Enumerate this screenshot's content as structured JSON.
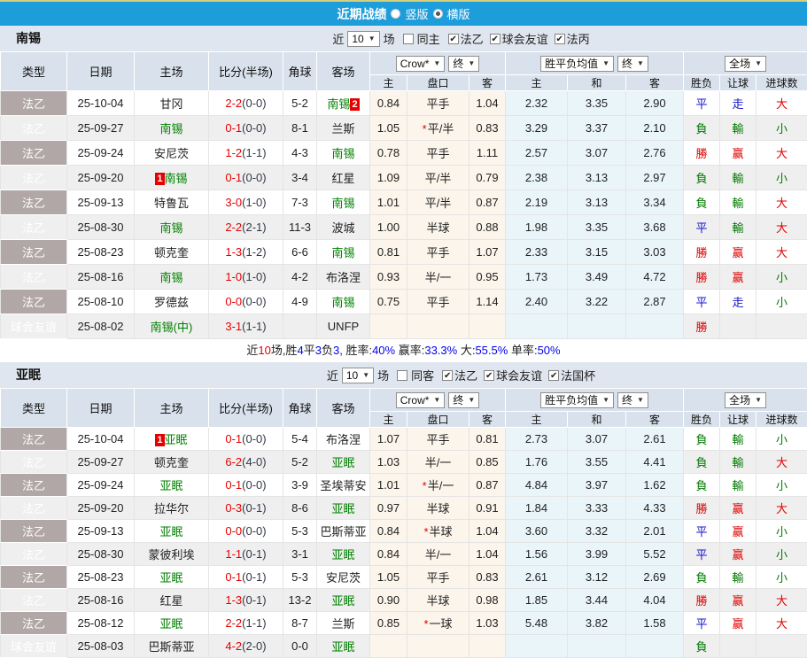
{
  "topbar": {
    "title": "近期战绩",
    "vertical": "竖版",
    "horizontal": "横版"
  },
  "value_colors": {
    "勝": "red",
    "平": "blue",
    "負": "green",
    "赢": "red",
    "走": "blue",
    "輸": "green",
    "大": "red",
    "小": "green"
  },
  "palette": {
    "topbar_blue": "#1E9DDB",
    "league_cell": "#B2A7A7",
    "friendly_cell": "#12A8A2",
    "odds_bg": "#FBF5EC",
    "avg_bg": "#EAF5FA",
    "stripe": "#EFEFEF",
    "red": "#E10000",
    "green": "#007A00",
    "blue": "#1414CC"
  },
  "sections": [
    {
      "team": "南锡",
      "near_label": "近",
      "count": "10",
      "games_label": "场",
      "same_checkbox": {
        "label": "同主",
        "checked": false
      },
      "league_checks": [
        {
          "label": "法乙",
          "checked": true
        },
        {
          "label": "球会友谊",
          "checked": true
        },
        {
          "label": "法丙",
          "checked": true
        }
      ],
      "selects": {
        "odds_company": "Crow*",
        "odds_final": "终",
        "avg": "胜平负均值",
        "avg_final": "终",
        "scope": "全场"
      },
      "columns": {
        "type": "类型",
        "date": "日期",
        "home": "主场",
        "score": "比分(半场)",
        "corner": "角球",
        "away": "客场",
        "o_home": "主",
        "o_line": "盘口",
        "o_away": "客",
        "e_home": "主",
        "e_draw": "和",
        "e_away": "客",
        "result": "胜负",
        "handicap": "让球",
        "goals": "进球数"
      },
      "rows": [
        {
          "type": "法乙",
          "friendly": false,
          "date": "25-10-04",
          "home": {
            "pre": "",
            "name": "甘冈",
            "post": "",
            "green": false
          },
          "score": "2-2",
          "half": "(0-0)",
          "corner": "5-2",
          "away": {
            "pre": "",
            "name": "南锡",
            "post": "2",
            "green": true
          },
          "star": false,
          "o1": "0.84",
          "line": "平手",
          "o2": "1.04",
          "e1": "2.32",
          "e2": "3.35",
          "e3": "2.90",
          "res": "平",
          "han": "走",
          "goal": "大"
        },
        {
          "type": "法乙",
          "friendly": false,
          "date": "25-09-27",
          "home": {
            "pre": "",
            "name": "南锡",
            "post": "",
            "green": true
          },
          "score": "0-1",
          "half": "(0-0)",
          "corner": "8-1",
          "away": {
            "pre": "",
            "name": "兰斯",
            "post": "",
            "green": false
          },
          "star": true,
          "o1": "1.05",
          "line": "平/半",
          "o2": "0.83",
          "e1": "3.29",
          "e2": "3.37",
          "e3": "2.10",
          "res": "負",
          "han": "輸",
          "goal": "小"
        },
        {
          "type": "法乙",
          "friendly": false,
          "date": "25-09-24",
          "home": {
            "pre": "",
            "name": "安尼茨",
            "post": "",
            "green": false
          },
          "score": "1-2",
          "half": "(1-1)",
          "corner": "4-3",
          "away": {
            "pre": "",
            "name": "南锡",
            "post": "",
            "green": true
          },
          "star": false,
          "o1": "0.78",
          "line": "平手",
          "o2": "1.11",
          "e1": "2.57",
          "e2": "3.07",
          "e3": "2.76",
          "res": "勝",
          "han": "赢",
          "goal": "大"
        },
        {
          "type": "法乙",
          "friendly": false,
          "date": "25-09-20",
          "home": {
            "pre": "1",
            "name": "南锡",
            "post": "",
            "green": true
          },
          "score": "0-1",
          "half": "(0-0)",
          "corner": "3-4",
          "away": {
            "pre": "",
            "name": "红星",
            "post": "",
            "green": false
          },
          "star": false,
          "o1": "1.09",
          "line": "平/半",
          "o2": "0.79",
          "e1": "2.38",
          "e2": "3.13",
          "e3": "2.97",
          "res": "負",
          "han": "輸",
          "goal": "小"
        },
        {
          "type": "法乙",
          "friendly": false,
          "date": "25-09-13",
          "home": {
            "pre": "",
            "name": "特鲁瓦",
            "post": "",
            "green": false
          },
          "score": "3-0",
          "half": "(1-0)",
          "corner": "7-3",
          "away": {
            "pre": "",
            "name": "南锡",
            "post": "",
            "green": true
          },
          "star": false,
          "o1": "1.01",
          "line": "平/半",
          "o2": "0.87",
          "e1": "2.19",
          "e2": "3.13",
          "e3": "3.34",
          "res": "負",
          "han": "輸",
          "goal": "大"
        },
        {
          "type": "法乙",
          "friendly": false,
          "date": "25-08-30",
          "home": {
            "pre": "",
            "name": "南锡",
            "post": "",
            "green": true
          },
          "score": "2-2",
          "half": "(2-1)",
          "corner": "11-3",
          "away": {
            "pre": "",
            "name": "波城",
            "post": "",
            "green": false
          },
          "star": false,
          "o1": "1.00",
          "line": "半球",
          "o2": "0.88",
          "e1": "1.98",
          "e2": "3.35",
          "e3": "3.68",
          "res": "平",
          "han": "輸",
          "goal": "大"
        },
        {
          "type": "法乙",
          "friendly": false,
          "date": "25-08-23",
          "home": {
            "pre": "",
            "name": "顿克奎",
            "post": "",
            "green": false
          },
          "score": "1-3",
          "half": "(1-2)",
          "corner": "6-6",
          "away": {
            "pre": "",
            "name": "南锡",
            "post": "",
            "green": true
          },
          "star": false,
          "o1": "0.81",
          "line": "平手",
          "o2": "1.07",
          "e1": "2.33",
          "e2": "3.15",
          "e3": "3.03",
          "res": "勝",
          "han": "赢",
          "goal": "大"
        },
        {
          "type": "法乙",
          "friendly": false,
          "date": "25-08-16",
          "home": {
            "pre": "",
            "name": "南锡",
            "post": "",
            "green": true
          },
          "score": "1-0",
          "half": "(1-0)",
          "corner": "4-2",
          "away": {
            "pre": "",
            "name": "布洛涅",
            "post": "",
            "green": false
          },
          "star": false,
          "o1": "0.93",
          "line": "半/一",
          "o2": "0.95",
          "e1": "1.73",
          "e2": "3.49",
          "e3": "4.72",
          "res": "勝",
          "han": "赢",
          "goal": "小"
        },
        {
          "type": "法乙",
          "friendly": false,
          "date": "25-08-10",
          "home": {
            "pre": "",
            "name": "罗德兹",
            "post": "",
            "green": false
          },
          "score": "0-0",
          "half": "(0-0)",
          "corner": "4-9",
          "away": {
            "pre": "",
            "name": "南锡",
            "post": "",
            "green": true
          },
          "star": false,
          "o1": "0.75",
          "line": "平手",
          "o2": "1.14",
          "e1": "2.40",
          "e2": "3.22",
          "e3": "2.87",
          "res": "平",
          "han": "走",
          "goal": "小"
        },
        {
          "type": "球会友谊",
          "friendly": true,
          "date": "25-08-02",
          "home": {
            "pre": "",
            "name": "南锡(中)",
            "post": "",
            "green": true
          },
          "score": "3-1",
          "half": "(1-1)",
          "corner": "",
          "away": {
            "pre": "",
            "name": "UNFP",
            "post": "",
            "green": false
          },
          "star": false,
          "o1": "",
          "line": "",
          "o2": "",
          "e1": "",
          "e2": "",
          "e3": "",
          "res": "勝",
          "han": "",
          "goal": ""
        }
      ],
      "summary": {
        "parts": [
          [
            "近",
            "k"
          ],
          [
            "10",
            "r"
          ],
          [
            "场,胜",
            "k"
          ],
          [
            "4",
            "b"
          ],
          [
            "平",
            "k"
          ],
          [
            "3",
            "b"
          ],
          [
            "负",
            "k"
          ],
          [
            "3",
            "b"
          ],
          [
            ", 胜率:",
            "k"
          ],
          [
            "40%",
            "b"
          ],
          [
            " 赢率:",
            "k"
          ],
          [
            "33.3%",
            "b"
          ],
          [
            " 大:",
            "k"
          ],
          [
            "55.5%",
            "b"
          ],
          [
            " 单率:",
            "k"
          ],
          [
            "50%",
            "b"
          ]
        ]
      }
    },
    {
      "team": "亚眠",
      "near_label": "近",
      "count": "10",
      "games_label": "场",
      "same_checkbox": {
        "label": "同客",
        "checked": false
      },
      "league_checks": [
        {
          "label": "法乙",
          "checked": true
        },
        {
          "label": "球会友谊",
          "checked": true
        },
        {
          "label": "法国杯",
          "checked": true
        }
      ],
      "selects": {
        "odds_company": "Crow*",
        "odds_final": "终",
        "avg": "胜平负均值",
        "avg_final": "终",
        "scope": "全场"
      },
      "columns": {
        "type": "类型",
        "date": "日期",
        "home": "主场",
        "score": "比分(半场)",
        "corner": "角球",
        "away": "客场",
        "o_home": "主",
        "o_line": "盘口",
        "o_away": "客",
        "e_home": "主",
        "e_draw": "和",
        "e_away": "客",
        "result": "胜负",
        "handicap": "让球",
        "goals": "进球数"
      },
      "rows": [
        {
          "type": "法乙",
          "friendly": false,
          "date": "25-10-04",
          "home": {
            "pre": "1",
            "name": "亚眠",
            "post": "",
            "green": true
          },
          "score": "0-1",
          "half": "(0-0)",
          "corner": "5-4",
          "away": {
            "pre": "",
            "name": "布洛涅",
            "post": "",
            "green": false
          },
          "star": false,
          "o1": "1.07",
          "line": "平手",
          "o2": "0.81",
          "e1": "2.73",
          "e2": "3.07",
          "e3": "2.61",
          "res": "負",
          "han": "輸",
          "goal": "小"
        },
        {
          "type": "法乙",
          "friendly": false,
          "date": "25-09-27",
          "home": {
            "pre": "",
            "name": "顿克奎",
            "post": "",
            "green": false
          },
          "score": "6-2",
          "half": "(4-0)",
          "corner": "5-2",
          "away": {
            "pre": "",
            "name": "亚眠",
            "post": "",
            "green": true
          },
          "star": false,
          "o1": "1.03",
          "line": "半/一",
          "o2": "0.85",
          "e1": "1.76",
          "e2": "3.55",
          "e3": "4.41",
          "res": "負",
          "han": "輸",
          "goal": "大"
        },
        {
          "type": "法乙",
          "friendly": false,
          "date": "25-09-24",
          "home": {
            "pre": "",
            "name": "亚眠",
            "post": "",
            "green": true
          },
          "score": "0-1",
          "half": "(0-0)",
          "corner": "3-9",
          "away": {
            "pre": "",
            "name": "圣埃蒂安",
            "post": "",
            "green": false
          },
          "star": true,
          "o1": "1.01",
          "line": "半/一",
          "o2": "0.87",
          "e1": "4.84",
          "e2": "3.97",
          "e3": "1.62",
          "res": "負",
          "han": "輸",
          "goal": "小"
        },
        {
          "type": "法乙",
          "friendly": false,
          "date": "25-09-20",
          "home": {
            "pre": "",
            "name": "拉华尔",
            "post": "",
            "green": false
          },
          "score": "0-3",
          "half": "(0-1)",
          "corner": "8-6",
          "away": {
            "pre": "",
            "name": "亚眠",
            "post": "",
            "green": true
          },
          "star": false,
          "o1": "0.97",
          "line": "半球",
          "o2": "0.91",
          "e1": "1.84",
          "e2": "3.33",
          "e3": "4.33",
          "res": "勝",
          "han": "赢",
          "goal": "大"
        },
        {
          "type": "法乙",
          "friendly": false,
          "date": "25-09-13",
          "home": {
            "pre": "",
            "name": "亚眠",
            "post": "",
            "green": true
          },
          "score": "0-0",
          "half": "(0-0)",
          "corner": "5-3",
          "away": {
            "pre": "",
            "name": "巴斯蒂亚",
            "post": "",
            "green": false
          },
          "star": true,
          "o1": "0.84",
          "line": "半球",
          "o2": "1.04",
          "e1": "3.60",
          "e2": "3.32",
          "e3": "2.01",
          "res": "平",
          "han": "赢",
          "goal": "小"
        },
        {
          "type": "法乙",
          "friendly": false,
          "date": "25-08-30",
          "home": {
            "pre": "",
            "name": "蒙彼利埃",
            "post": "",
            "green": false
          },
          "score": "1-1",
          "half": "(0-1)",
          "corner": "3-1",
          "away": {
            "pre": "",
            "name": "亚眠",
            "post": "",
            "green": true
          },
          "star": false,
          "o1": "0.84",
          "line": "半/一",
          "o2": "1.04",
          "e1": "1.56",
          "e2": "3.99",
          "e3": "5.52",
          "res": "平",
          "han": "赢",
          "goal": "小"
        },
        {
          "type": "法乙",
          "friendly": false,
          "date": "25-08-23",
          "home": {
            "pre": "",
            "name": "亚眠",
            "post": "",
            "green": true
          },
          "score": "0-1",
          "half": "(0-1)",
          "corner": "5-3",
          "away": {
            "pre": "",
            "name": "安尼茨",
            "post": "",
            "green": false
          },
          "star": false,
          "o1": "1.05",
          "line": "平手",
          "o2": "0.83",
          "e1": "2.61",
          "e2": "3.12",
          "e3": "2.69",
          "res": "負",
          "han": "輸",
          "goal": "小"
        },
        {
          "type": "法乙",
          "friendly": false,
          "date": "25-08-16",
          "home": {
            "pre": "",
            "name": "红星",
            "post": "",
            "green": false
          },
          "score": "1-3",
          "half": "(0-1)",
          "corner": "13-2",
          "away": {
            "pre": "",
            "name": "亚眠",
            "post": "",
            "green": true
          },
          "star": false,
          "o1": "0.90",
          "line": "半球",
          "o2": "0.98",
          "e1": "1.85",
          "e2": "3.44",
          "e3": "4.04",
          "res": "勝",
          "han": "赢",
          "goal": "大"
        },
        {
          "type": "法乙",
          "friendly": false,
          "date": "25-08-12",
          "home": {
            "pre": "",
            "name": "亚眠",
            "post": "",
            "green": true
          },
          "score": "2-2",
          "half": "(1-1)",
          "corner": "8-7",
          "away": {
            "pre": "",
            "name": "兰斯",
            "post": "",
            "green": false
          },
          "star": true,
          "o1": "0.85",
          "line": "一球",
          "o2": "1.03",
          "e1": "5.48",
          "e2": "3.82",
          "e3": "1.58",
          "res": "平",
          "han": "赢",
          "goal": "大"
        },
        {
          "type": "球会友谊",
          "friendly": true,
          "date": "25-08-03",
          "home": {
            "pre": "",
            "name": "巴斯蒂亚",
            "post": "",
            "green": false
          },
          "score": "4-2",
          "half": "(2-0)",
          "corner": "0-0",
          "away": {
            "pre": "",
            "name": "亚眠",
            "post": "",
            "green": true
          },
          "star": false,
          "o1": "",
          "line": "",
          "o2": "",
          "e1": "",
          "e2": "",
          "e3": "",
          "res": "負",
          "han": "",
          "goal": ""
        }
      ],
      "summary": null
    }
  ]
}
